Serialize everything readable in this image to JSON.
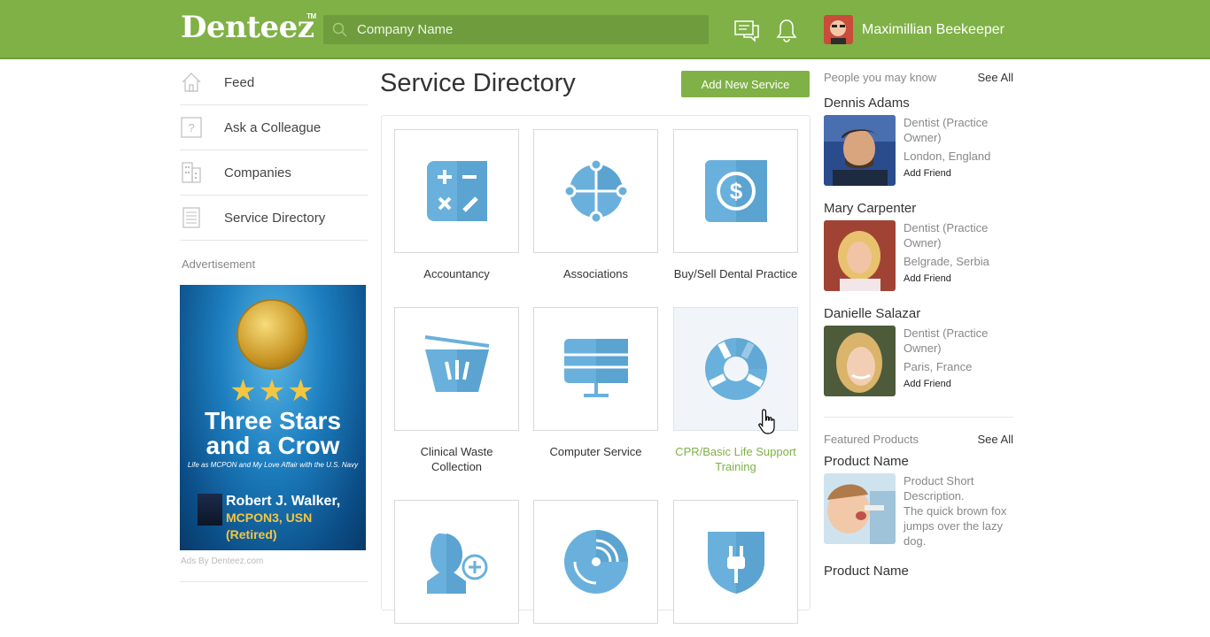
{
  "header": {
    "logo": "Denteez",
    "logo_tm": "TM",
    "search_placeholder": "Company Name",
    "user_name": "Maximillian Beekeeper"
  },
  "sidebar": {
    "items": [
      {
        "label": "Feed",
        "icon": "home-icon"
      },
      {
        "label": "Ask a Colleague",
        "icon": "question-icon"
      },
      {
        "label": "Companies",
        "icon": "building-icon"
      },
      {
        "label": "Service Directory",
        "icon": "document-icon"
      }
    ],
    "ad_label": "Advertisement",
    "ad": {
      "title": "Three Stars and a Crow",
      "subtitle": "Life as MCPON and My Love Affair with the U.S. Navy",
      "author": "Robert J. Walker,",
      "author_title": "MCPON3, USN (Retired)"
    },
    "ads_by": "Ads By Denteez.com"
  },
  "main": {
    "title": "Service Directory",
    "add_button": "Add New Service",
    "services": [
      {
        "label": "Accountancy",
        "icon": "calculator-icon"
      },
      {
        "label": "Associations",
        "icon": "network-icon"
      },
      {
        "label": "Buy/Sell Dental Practice",
        "icon": "dollar-icon"
      },
      {
        "label": "Clinical Waste Collection",
        "icon": "bin-icon"
      },
      {
        "label": "Computer Service",
        "icon": "monitor-icon"
      },
      {
        "label": "CPR/Basic Life Support Training",
        "icon": "lifebuoy-icon"
      },
      {
        "label": "",
        "icon": "add-person-icon"
      },
      {
        "label": "",
        "icon": "disc-icon"
      },
      {
        "label": "",
        "icon": "shield-plug-icon"
      }
    ]
  },
  "right": {
    "people_title": "People you may know",
    "see_all": "See All",
    "people": [
      {
        "name": "Dennis Adams",
        "role": "Dentist (Practice Owner)",
        "location": "London, England",
        "action": "Add Friend"
      },
      {
        "name": "Mary Carpenter",
        "role": "Dentist (Practice Owner)",
        "location": "Belgrade, Serbia",
        "action": "Add Friend"
      },
      {
        "name": "Danielle Salazar",
        "role": "Dentist (Practice Owner)",
        "location": "Paris, France",
        "action": "Add Friend"
      }
    ],
    "products_title": "Featured Products",
    "products": [
      {
        "name": "Product Name",
        "description": "Product Short Description.",
        "body": "The quick brown fox jumps over the lazy dog."
      },
      {
        "name": "Product Name"
      }
    ]
  },
  "colors": {
    "brand_green": "#7fb146",
    "icon_blue": "#6ab0dc"
  }
}
